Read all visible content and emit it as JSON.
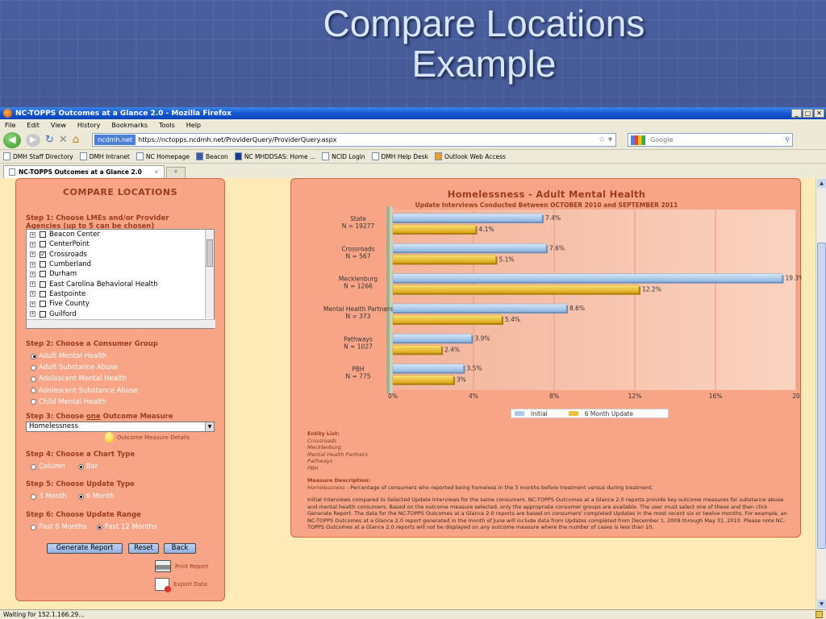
{
  "slide": {
    "title_line1": "Compare Locations",
    "title_line2": "Example"
  },
  "browser": {
    "window_title": "NC-TOPPS Outcomes at a Glance 2.0 - Mozilla Firefox",
    "menu": [
      "File",
      "Edit",
      "View",
      "History",
      "Bookmarks",
      "Tools",
      "Help"
    ],
    "site_badge": "ncdmh.net",
    "url": "https://nctopps.ncdmh.net/ProviderQuery/ProviderQuery.aspx",
    "search_placeholder": "Google",
    "bookmarks": [
      "DMH Staff Directory",
      "DMH Intranet",
      "NC Homepage",
      "Beacon",
      "NC MHDDSAS: Home ...",
      "NCID Login",
      "DMH Help Desk",
      "Outlook Web Access"
    ],
    "tab_label": "NC-TOPPS Outcomes at a Glance 2.0",
    "status": "Waiting for 152.1.166.29...",
    "colors": {
      "titlebar": "#1657d4",
      "panel": "#f7a586",
      "page_bg": "#fdeab7",
      "accent_text": "#9a3d1e"
    }
  },
  "form": {
    "title": "COMPARE LOCATIONS",
    "step1_line1": "Step 1: Choose LMEs and/or Provider",
    "step1_line2": "Agencies (up to 5 can be chosen)",
    "locations": [
      {
        "label": "Beacon Center",
        "checked": false
      },
      {
        "label": "CenterPoint",
        "checked": false
      },
      {
        "label": "Crossroads",
        "checked": true
      },
      {
        "label": "Cumberland",
        "checked": false
      },
      {
        "label": "Durham",
        "checked": false
      },
      {
        "label": "East Carolina Behavioral Health",
        "checked": false
      },
      {
        "label": "Eastpointe",
        "checked": false
      },
      {
        "label": "Five County",
        "checked": false
      },
      {
        "label": "Guilford",
        "checked": false
      }
    ],
    "step2": "Step 2: Choose a Consumer Group",
    "groups": [
      {
        "label": "Adult Mental Health",
        "selected": true
      },
      {
        "label": "Adult Substance Abuse",
        "selected": false
      },
      {
        "label": "Adolescent Mental Health",
        "selected": false
      },
      {
        "label": "Adolescent Substance Abuse",
        "selected": false
      },
      {
        "label": "Child Mental Health",
        "selected": false
      }
    ],
    "step3_pre": "Step 3: Choose ",
    "step3_one": "one",
    "step3_post": " Outcome Measure",
    "measure_value": "Homelessness",
    "measure_details": "Outcome Measure Details",
    "step4": "Step 4: Choose a Chart Type",
    "chart_column": "Column",
    "chart_bar": "Bar",
    "step5": "Step 5: Choose Update Type",
    "upd_3": "3 Month",
    "upd_6": "6 Month",
    "step6": "Step 6: Choose Update Range",
    "range_6": "Past 6 Months",
    "range_12": "Past 12 Months",
    "btn_generate": "Generate Report",
    "btn_reset": "Reset",
    "btn_back": "Back",
    "print_report": "Print Report",
    "export_data": "Export Data"
  },
  "chart_data": {
    "type": "bar",
    "orientation": "horizontal",
    "title": "Homelessness - Adult Mental Health",
    "subtitle": "Update Interviews Conducted Between OCTOBER 2010 and SEPTEMBER 2011",
    "categories": [
      {
        "name": "State",
        "n": "N = 19277"
      },
      {
        "name": "Crossroads",
        "n": "N = 567"
      },
      {
        "name": "Mecklenburg",
        "n": "N = 1266"
      },
      {
        "name": "Mental Health Partners",
        "n": "N = 373"
      },
      {
        "name": "Pathways",
        "n": "N = 1027"
      },
      {
        "name": "PBH",
        "n": "N = 775"
      }
    ],
    "series": [
      {
        "name": "Initial",
        "values": [
          7.4,
          7.6,
          19.3,
          8.6,
          3.9,
          3.5
        ],
        "labels": [
          "7.4%",
          "7.6%",
          "19.3%",
          "8.6%",
          "3.9%",
          "3.5%"
        ],
        "color": "#a9c8ea"
      },
      {
        "name": "6 Month Update",
        "values": [
          4.1,
          5.1,
          12.2,
          5.4,
          2.4,
          3.0
        ],
        "labels": [
          "4.1%",
          "5.1%",
          "12.2%",
          "5.4%",
          "2.4%",
          "3%"
        ],
        "color": "#f0c23a"
      }
    ],
    "xlim": [
      0,
      20
    ],
    "ticks": [
      "0%",
      "4%",
      "8%",
      "12%",
      "16%",
      "20"
    ],
    "grid": true,
    "legend_position": "bottom"
  },
  "entity": {
    "list_label": "Entity List:",
    "list": [
      "Crossroads",
      "Mecklenburg",
      "Mental Health Partners",
      "Pathways",
      "PBH"
    ],
    "measure_label": "Measure Description:",
    "measure_name": "Homelessness",
    "measure_text": " - Percentage of consumers who reported being homeless in the 3 months before treatment versus during treatment.",
    "para_1": "Initial Interviews compared to Selected Update Interviews for the same consumers. NC-TOPPS Outcomes at a Glance 2.0 reports provide key outcome measures for substance abuse and mental health consumers. Based on the outcome measure selected, only the appropriate consumer groups are available. The user must select one of these and then click Generate Report. The data for the NC-TOPPS Outcomes at a Glance 2.0 reports are based on consumers' completed Updates in the most recent six or twelve months. For example, an NC-TOPPS Outcomes at a Glance 2.0 report generated in the month of June will include data from Updates completed from December 1, 2009 through May 31, 2010. Please note NC-TOPPS Outcomes at a Glance 2.0 reports will not be displayed on any outcome measure where the number of cases is less than 10."
  }
}
